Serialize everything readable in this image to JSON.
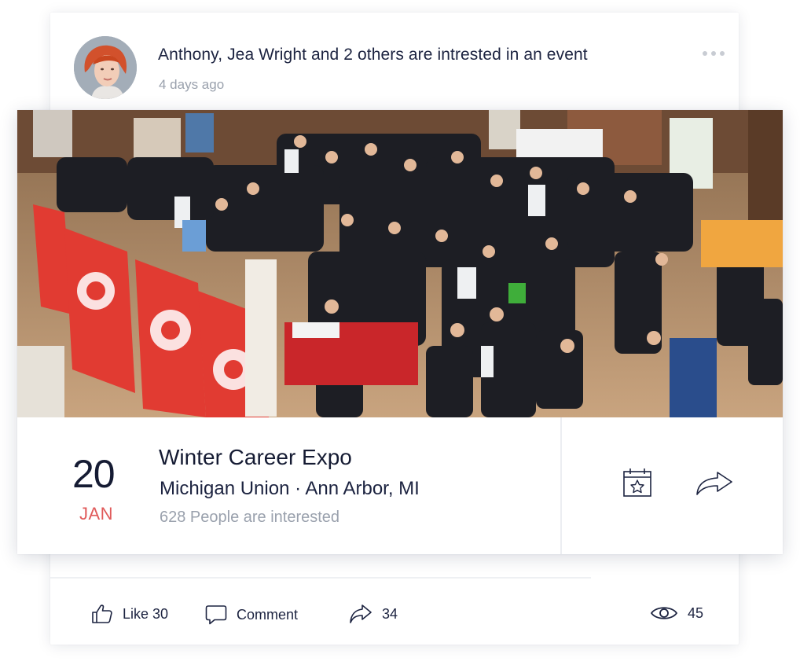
{
  "post": {
    "header_text": "Anthony, Jea Wright and 2 others are intrested in an event",
    "time_ago": "4 days ago"
  },
  "event": {
    "day": "20",
    "month": "JAN",
    "title": "Winter Career Expo",
    "location": "Michigan Union · Ann Arbor, MI",
    "interested": "628 People are interested",
    "photo_icon": "career-fair-crowd-photo",
    "calendar_icon": "calendar-star-icon",
    "share_icon": "share-arrow-icon"
  },
  "actions": {
    "like_label": "Like 30",
    "comment_label": "Comment",
    "share_count": "34",
    "views_count": "45"
  },
  "colors": {
    "accent_month": "#e05a5a",
    "text_dark": "#151b33",
    "text_muted": "#9aa1ad"
  }
}
